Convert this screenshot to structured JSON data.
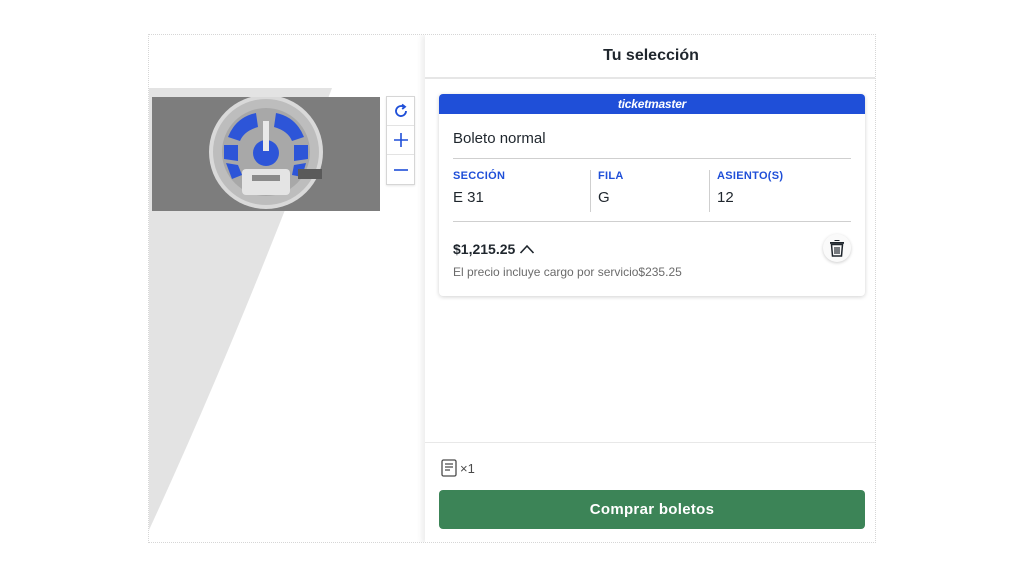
{
  "panel": {
    "title": "Tu selección"
  },
  "ticket": {
    "brand": "ticketmaster",
    "type": "Boleto normal",
    "seat_columns": [
      {
        "label": "SECCIÓN",
        "value": "E 31"
      },
      {
        "label": "FILA",
        "value": "G"
      },
      {
        "label": "ASIENTO(S)",
        "value": "12"
      }
    ],
    "price": "$1,215.25",
    "price_note": "El precio incluye cargo por servicio$235.25"
  },
  "footer": {
    "quantity": "×1",
    "buy_label": "Comprar boletos"
  },
  "map_controls": [
    "reset-icon",
    "zoom-in-icon",
    "zoom-out-icon"
  ],
  "colors": {
    "brand_blue": "#1f4fd8",
    "buy_green": "#3c8457",
    "selected_section": "#2d55d8"
  }
}
